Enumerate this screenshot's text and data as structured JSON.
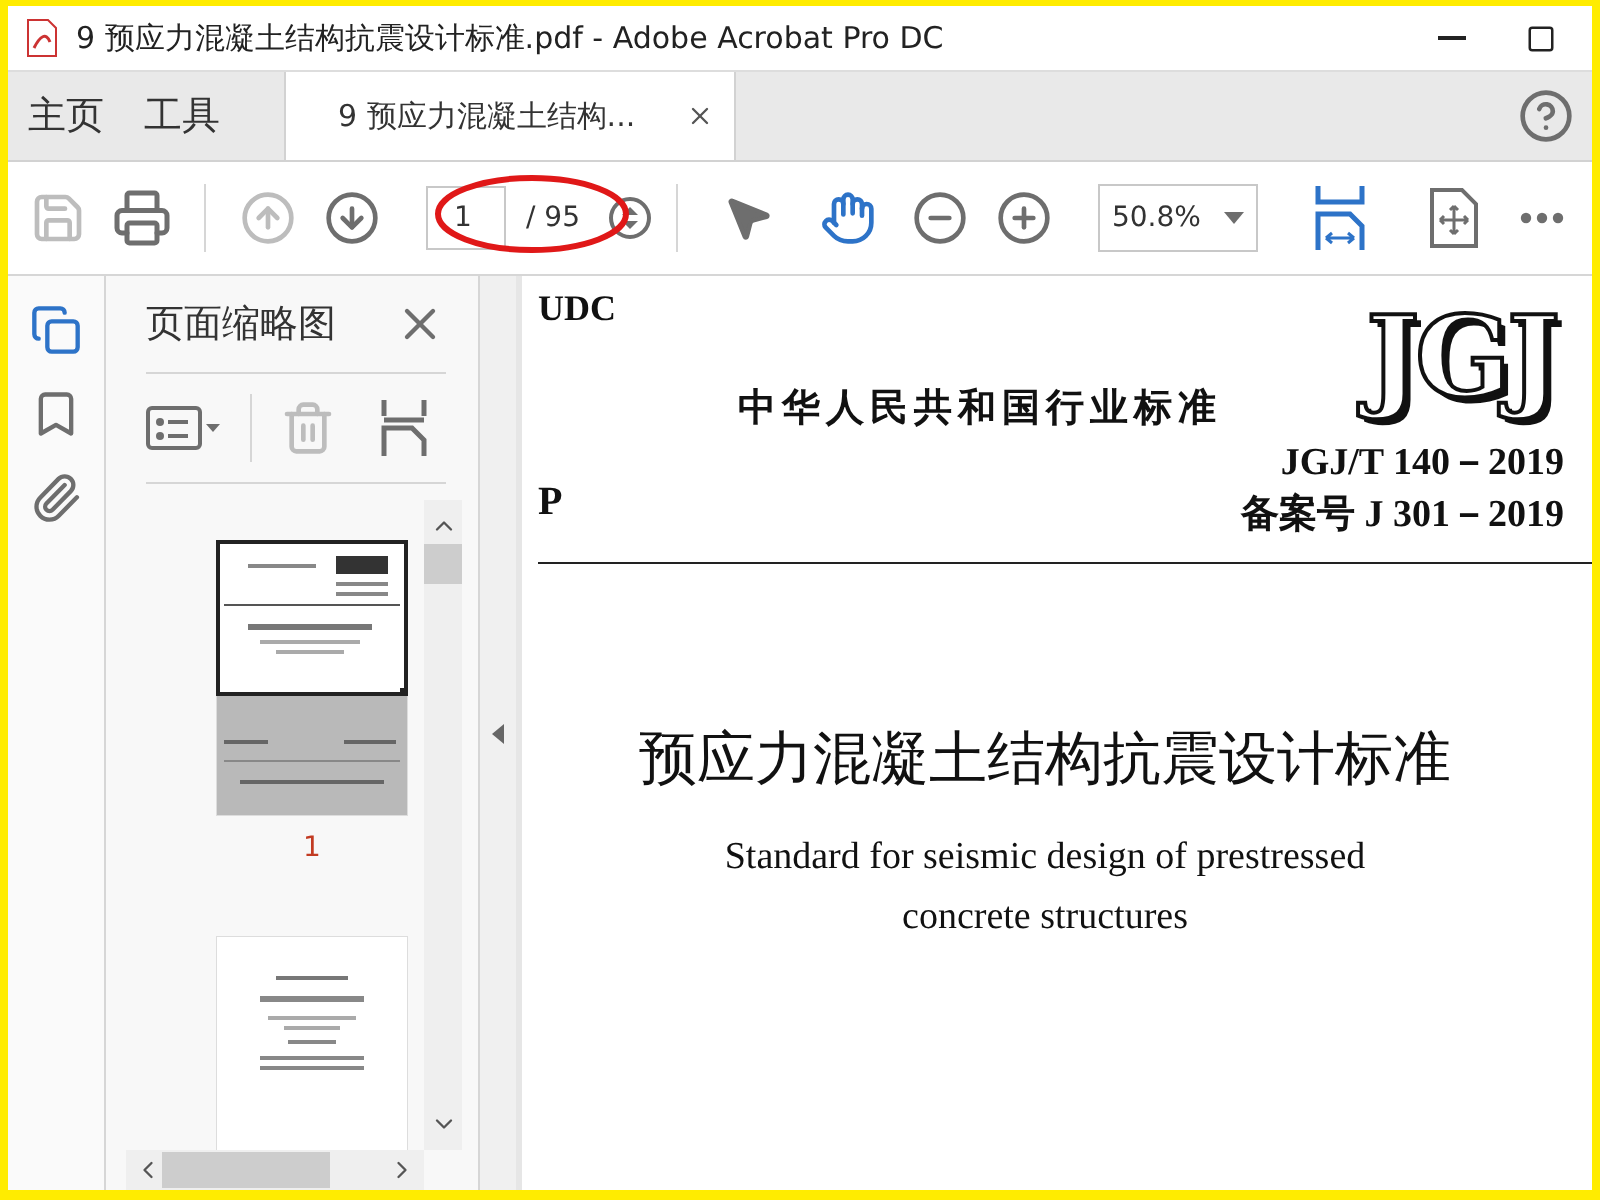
{
  "window": {
    "title": "9 预应力混凝土结构抗震设计标准.pdf - Adobe Acrobat Pro DC"
  },
  "nav_tabs": [
    {
      "label": "主页"
    },
    {
      "label": "工具"
    }
  ],
  "doc_tabs": [
    {
      "label": "9 预应力混凝土结构...",
      "selected": true
    }
  ],
  "toolbar": {
    "save_disabled": true,
    "prev_disabled": true,
    "next_disabled": false,
    "page_current": "1",
    "page_total": "/ 95",
    "zoom": "50.8%",
    "tools": [
      {
        "kind": "select",
        "selected": false
      },
      {
        "kind": "hand",
        "selected": true
      }
    ]
  },
  "side_rail": [
    {
      "kind": "thumbnails",
      "selected": true
    },
    {
      "kind": "bookmarks",
      "selected": false
    },
    {
      "kind": "attachments",
      "selected": false
    }
  ],
  "thumbnail_pane": {
    "title": "页面缩略图",
    "delete_disabled": true,
    "pages": [
      {
        "kind": "cover",
        "label": "1",
        "selected": true
      },
      {
        "kind": "title",
        "selected": false
      }
    ]
  },
  "document": {
    "udc": "UDC",
    "header": "中华人民共和国行业标准",
    "logo": "JGJ",
    "classification": "P",
    "code": "JGJ/T 140－2019",
    "record": "备案号 J 301－2019",
    "title": "预应力混凝土结构抗震设计标准",
    "subtitle_lines": [
      "Standard for seismic design of prestressed",
      "concrete structures"
    ]
  },
  "annotations": [
    {
      "kind": "ellipse"
    }
  ]
}
